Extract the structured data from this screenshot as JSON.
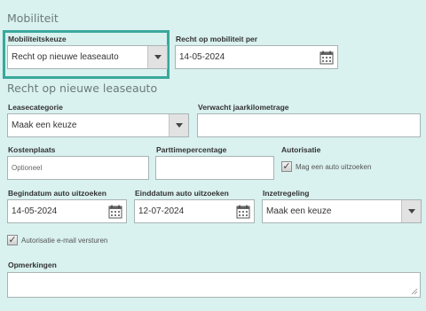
{
  "section_mobiliteit": {
    "title": "Mobiliteit"
  },
  "mobiliteitskeuze": {
    "label": "Mobiliteitskeuze",
    "value": "Recht op nieuwe leaseauto"
  },
  "recht_op_mobiliteit_per": {
    "label": "Recht op mobiliteit per",
    "value": "14-05-2024"
  },
  "section_leaseauto": {
    "title": "Recht op nieuwe leaseauto"
  },
  "leasecategorie": {
    "label": "Leasecategorie",
    "value": "Maak een keuze"
  },
  "jaarkilometrage": {
    "label": "Verwacht jaarkilometrage",
    "value": ""
  },
  "kostenplaats": {
    "label": "Kostenplaats",
    "placeholder": "Optioneel"
  },
  "parttimepercentage": {
    "label": "Parttimepercentage",
    "value": ""
  },
  "autorisatie": {
    "label": "Autorisatie",
    "checkbox_label": "Mag een auto uitzoeken",
    "checked": true
  },
  "begindatum": {
    "label": "Begindatum auto uitzoeken",
    "value": "14-05-2024"
  },
  "einddatum": {
    "label": "Einddatum auto uitzoeken",
    "value": "12-07-2024"
  },
  "inzetregeling": {
    "label": "Inzetregeling",
    "value": "Maak een keuze"
  },
  "email_autorisatie": {
    "checkbox_label": "Autorisatie e-mail versturen",
    "checked": true
  },
  "opmerkingen": {
    "label": "Opmerkingen",
    "value": ""
  },
  "icons": {
    "calendar": "calendar-icon",
    "dropdown": "chevron-down-icon",
    "check": "checkmark-icon",
    "resize": "resize-grip-icon"
  },
  "colors": {
    "background": "#d9f1ef",
    "highlight": "#3aa89c",
    "field_border": "#a8b4b4"
  }
}
